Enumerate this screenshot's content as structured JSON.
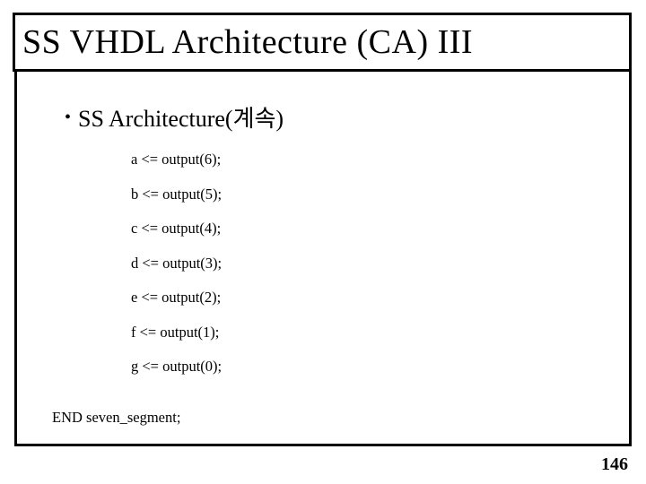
{
  "title": "SS VHDL Architecture (CA) III",
  "bullet": "SS Architecture(계속)",
  "code": {
    "lines": [
      "a <= output(6);",
      "b <= output(5);",
      "c <= output(4);",
      "d <= output(3);",
      "e <= output(2);",
      "f <= output(1);",
      "g <= output(0);"
    ],
    "end": "END seven_segment;"
  },
  "page_number": "146"
}
